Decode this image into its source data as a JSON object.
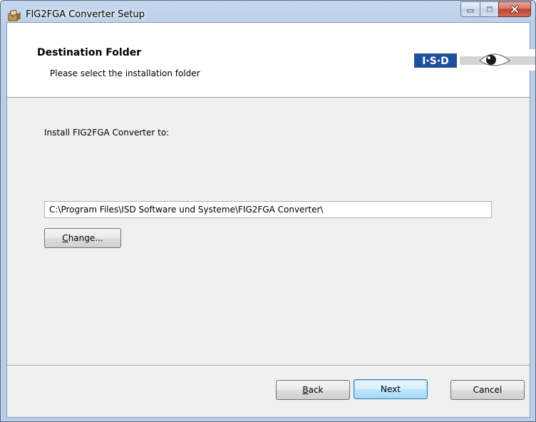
{
  "window": {
    "title": "FIG2FGA Converter Setup",
    "minimize_icon": "minimize-icon",
    "maximize_icon": "maximize-icon",
    "close_icon": "close-icon"
  },
  "header": {
    "title": "Destination Folder",
    "subtitle": "Please select the installation folder",
    "logo_text": "I·S·D"
  },
  "main": {
    "install_label": "Install FIG2FGA Converter to:",
    "install_path": "C:\\Program Files\\ISD Software und Systeme\\FIG2FGA Converter\\",
    "change_button": {
      "accel": "C",
      "rest": "hange..."
    }
  },
  "footer": {
    "back_button": {
      "accel": "B",
      "rest": "ack"
    },
    "next_button": "Next",
    "cancel_button": "Cancel"
  },
  "colors": {
    "titlebar": "#b9cee9",
    "close_button": "#c2412f",
    "client_background": "#f0f0f0",
    "default_button_border": "#3c7fb1"
  }
}
